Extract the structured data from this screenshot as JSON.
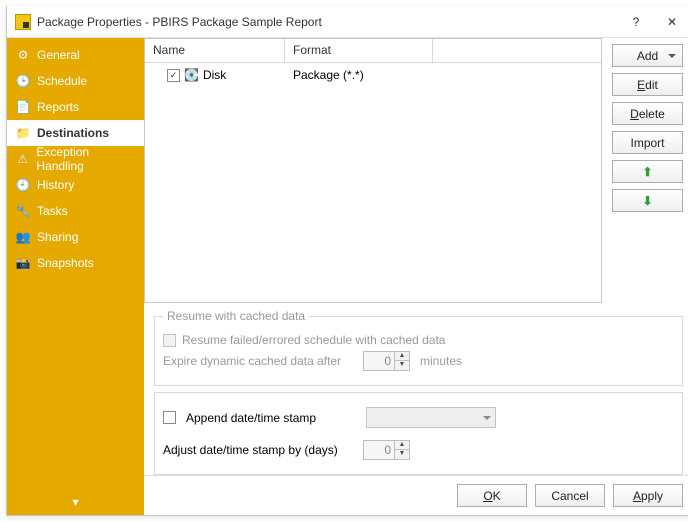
{
  "title": "Package Properties - PBIRS Package Sample Report",
  "sidebar": {
    "items": [
      {
        "label": "General",
        "icon": "⚙"
      },
      {
        "label": "Schedule",
        "icon": "🕒"
      },
      {
        "label": "Reports",
        "icon": "📄"
      },
      {
        "label": "Destinations",
        "icon": "📁"
      },
      {
        "label": "Exception Handling",
        "icon": "⚠"
      },
      {
        "label": "History",
        "icon": "🕘"
      },
      {
        "label": "Tasks",
        "icon": "🔧"
      },
      {
        "label": "Sharing",
        "icon": "👥"
      },
      {
        "label": "Snapshots",
        "icon": "📸"
      }
    ]
  },
  "table": {
    "headers": {
      "name": "Name",
      "format": "Format"
    },
    "rows": [
      {
        "checked": true,
        "name": "Disk",
        "format": "Package (*.*)"
      }
    ]
  },
  "buttons": {
    "add": "Add",
    "edit": "Edit",
    "delete": "Delete",
    "import": "Import",
    "up": "⬆",
    "down": "⬇"
  },
  "resume": {
    "legend": "Resume with cached data",
    "checkbox_label": "Resume failed/errored schedule with cached data",
    "expire_label": "Expire dynamic cached data after",
    "expire_value": "0",
    "expire_unit": "minutes"
  },
  "append": {
    "checkbox_label": "Append date/time stamp",
    "adjust_label": "Adjust date/time stamp by (days)",
    "adjust_value": "0"
  },
  "footer": {
    "ok": "OK",
    "cancel": "Cancel",
    "apply": "Apply"
  }
}
